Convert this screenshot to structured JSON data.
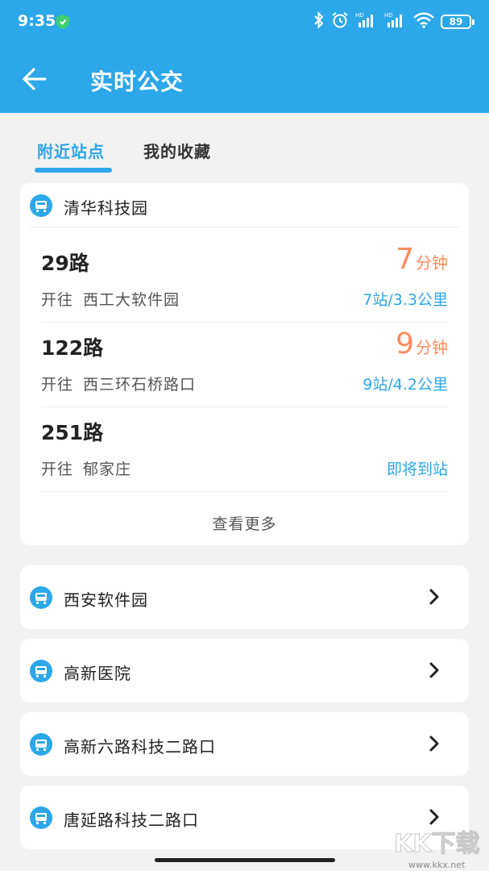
{
  "status_bar": {
    "time": "9:35",
    "battery": "89",
    "icons": [
      "shield-icon",
      "bluetooth-icon",
      "alarm-icon",
      "signal-hd-icon",
      "signal-hd-icon",
      "wifi-icon",
      "battery-icon"
    ]
  },
  "header": {
    "title": "实时公交",
    "back_icon": "back-arrow-icon",
    "background": "#2ba7ea"
  },
  "tabs": [
    {
      "label": "附近站点",
      "active": true
    },
    {
      "label": "我的收藏",
      "active": false
    }
  ],
  "nearby": {
    "stop_name": "清华科技园",
    "routes": [
      {
        "name": "29路",
        "direction_label": "开往",
        "destination": "西工大软件园",
        "eta_value": "7",
        "eta_unit": "分钟",
        "distance": "7站/3.3公里"
      },
      {
        "name": "122路",
        "direction_label": "开往",
        "destination": "西三环石桥路口",
        "eta_value": "9",
        "eta_unit": "分钟",
        "distance": "9站/4.2公里"
      },
      {
        "name": "251路",
        "direction_label": "开往",
        "destination": "郁家庄",
        "eta_value": "",
        "eta_unit": "",
        "distance": "即将到站"
      }
    ],
    "more_label": "查看更多"
  },
  "other_stops": [
    {
      "name": "西安软件园"
    },
    {
      "name": "高新医院"
    },
    {
      "name": "高新六路科技二路口"
    },
    {
      "name": "唐延路科技二路口"
    }
  ],
  "watermark": {
    "text": "KK下载",
    "url": "www.kkx.net"
  },
  "colors": {
    "accent": "#2ba7ea",
    "eta": "#ff8a5b",
    "page_bg": "#f2f2f2"
  }
}
